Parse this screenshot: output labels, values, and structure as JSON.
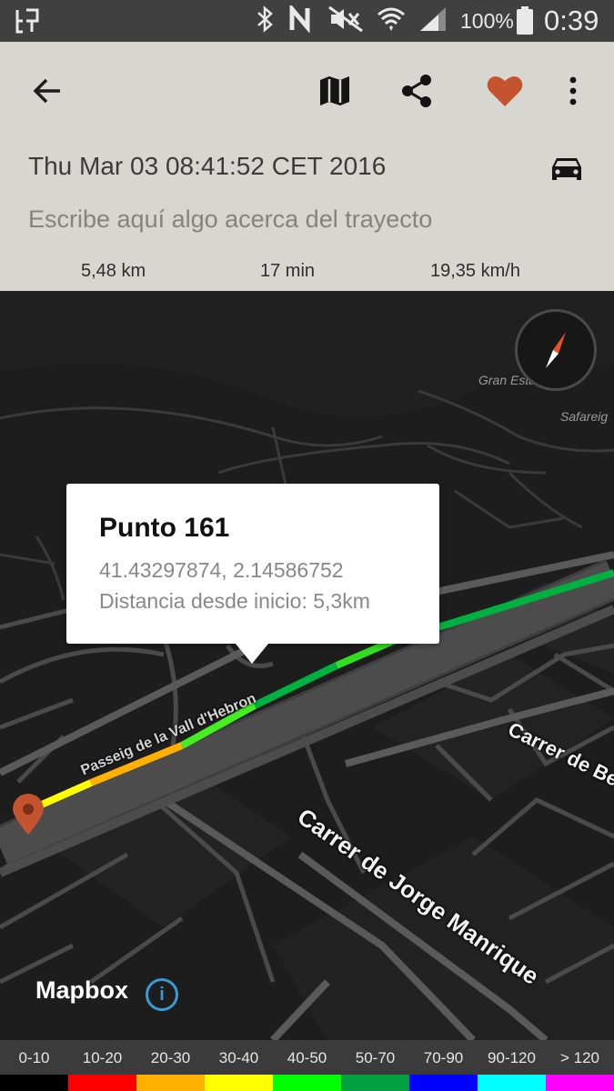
{
  "status_bar": {
    "battery_percent": "100%",
    "time": "0:39",
    "icons": [
      "network-icon",
      "bluetooth-icon",
      "nfc-icon",
      "mute-icon",
      "wifi-icon",
      "signal-icon",
      "battery-icon"
    ]
  },
  "toolbar": {
    "icons": [
      "back-arrow-icon",
      "map-icon",
      "share-icon",
      "heart-icon",
      "more-vert-icon"
    ],
    "favorite_color": "#c4542f"
  },
  "trip": {
    "date": "Thu Mar 03 08:41:52 CET 2016",
    "description_placeholder": "Escribe aquí algo acerca del trayecto",
    "transport_icon": "car-icon",
    "stats": {
      "distance": "5,48 km",
      "duration": "17 min",
      "avg_speed": "19,35 km/h"
    }
  },
  "map": {
    "popup": {
      "title": "Punto 161",
      "coordinates": "41.43297874, 2.14586752",
      "distance_label": "Distancia desde inicio: 5,3km"
    },
    "places": {
      "gran_estany": "Gran Estany",
      "safareig": "Safareig"
    },
    "streets": {
      "street1": "Carrer de Jorge Manrique",
      "street2": "Carrer de Be",
      "street3": "Passeig de la Vall d'Hebron"
    },
    "attribution": "Mapbox",
    "marker_color": "#c4542f"
  },
  "legend": {
    "ranges": [
      {
        "label": "0-10",
        "color": "#000000"
      },
      {
        "label": "10-20",
        "color": "#ff0000"
      },
      {
        "label": "20-30",
        "color": "#ffb000"
      },
      {
        "label": "30-40",
        "color": "#ffff00"
      },
      {
        "label": "40-50",
        "color": "#00ff00"
      },
      {
        "label": "50-70",
        "color": "#00a040"
      },
      {
        "label": "70-90",
        "color": "#0000ff"
      },
      {
        "label": "90-120",
        "color": "#00ffff"
      },
      {
        "label": "> 120",
        "color": "#ff00ff"
      }
    ]
  }
}
